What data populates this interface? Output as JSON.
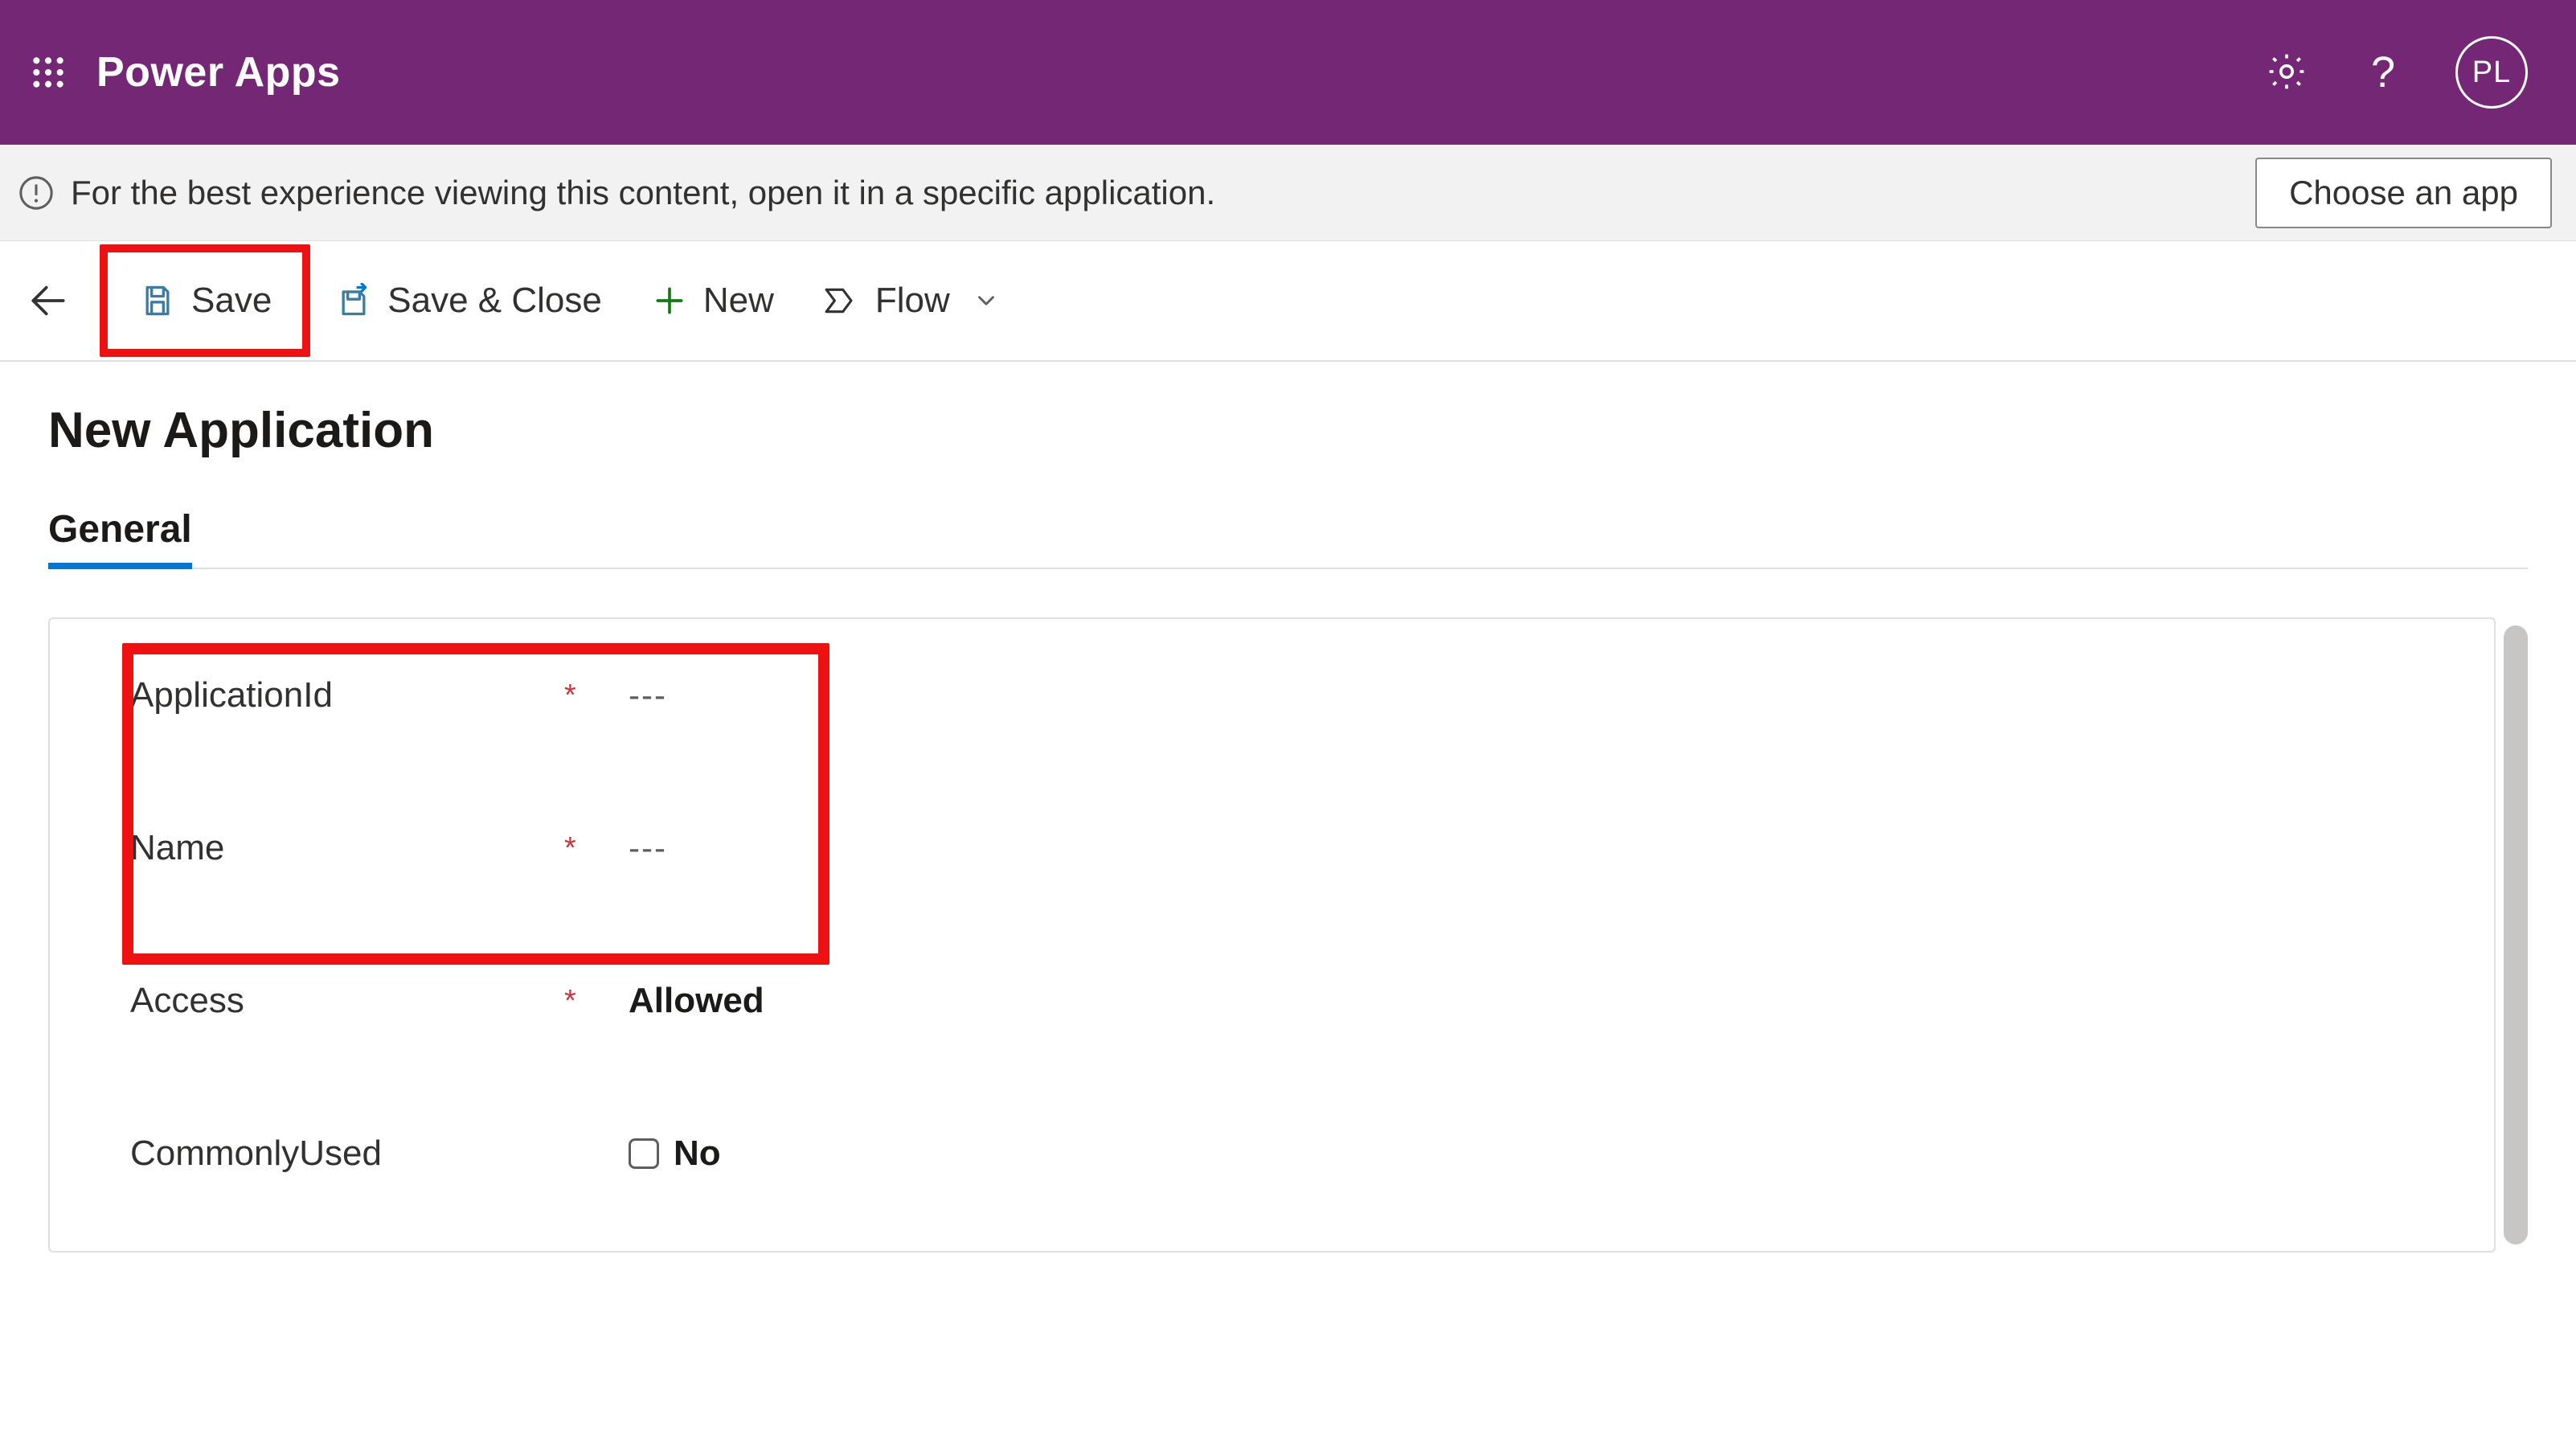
{
  "header": {
    "app_name": "Power Apps",
    "avatar_initials": "PL"
  },
  "info_bar": {
    "message": "For the best experience viewing this content, open it in a specific application.",
    "choose_app_label": "Choose an app"
  },
  "command_bar": {
    "save_label": "Save",
    "save_close_label": "Save & Close",
    "new_label": "New",
    "flow_label": "Flow"
  },
  "page": {
    "title": "New Application",
    "tabs": [
      {
        "label": "General",
        "active": true
      }
    ]
  },
  "form": {
    "fields": {
      "application_id": {
        "label": "ApplicationId",
        "required": true,
        "value": "---"
      },
      "name": {
        "label": "Name",
        "required": true,
        "value": "---"
      },
      "access": {
        "label": "Access",
        "required": true,
        "value": "Allowed"
      },
      "commonly_used": {
        "label": "CommonlyUsed",
        "required": false,
        "value": "No",
        "checked": false
      }
    }
  },
  "required_marker": "*"
}
